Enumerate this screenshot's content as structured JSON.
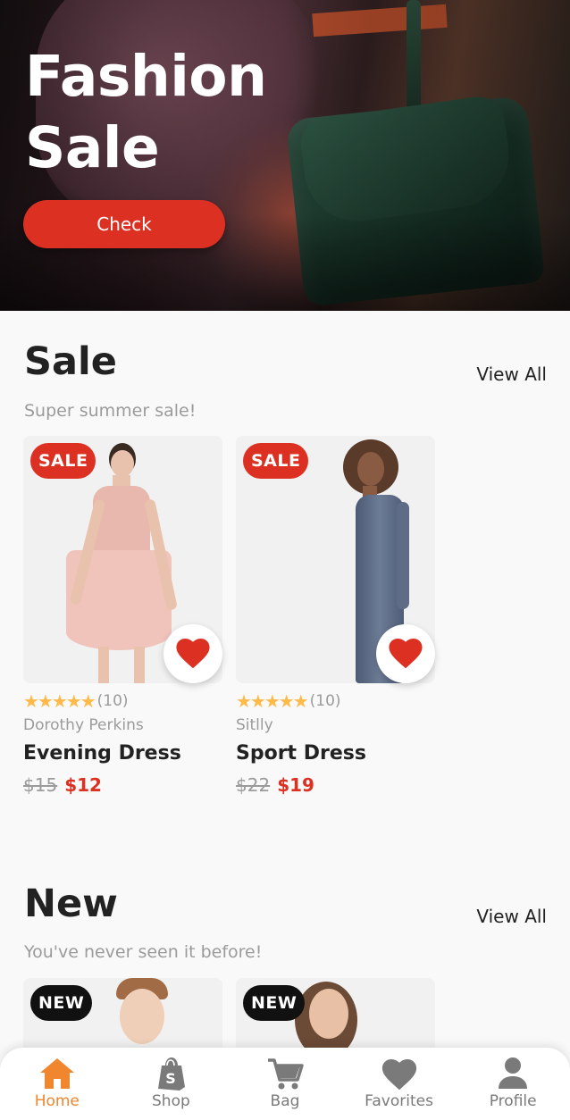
{
  "hero": {
    "title_line1": "Fashion",
    "title_line2": "Sale",
    "cta_label": "Check"
  },
  "sale": {
    "title": "Sale",
    "view_all": "View All",
    "subtitle": "Super summer sale!",
    "products": [
      {
        "badge": "SALE",
        "rating_stars": 5,
        "rating_count": "(10)",
        "brand": "Dorothy Perkins",
        "name": "Evening Dress",
        "old_price": "$15",
        "price": "$12"
      },
      {
        "badge": "SALE",
        "rating_stars": 5,
        "rating_count": "(10)",
        "brand": "Sitlly",
        "name": "Sport Dress",
        "old_price": "$22",
        "price": "$19"
      }
    ]
  },
  "new": {
    "title": "New",
    "view_all": "View All",
    "subtitle": "You've never seen it before!",
    "products": [
      {
        "badge": "NEW"
      },
      {
        "badge": "NEW"
      }
    ]
  },
  "nav": {
    "items": [
      {
        "label": "Home",
        "icon": "home-icon",
        "active": true
      },
      {
        "label": "Shop",
        "icon": "shop-bag-icon",
        "active": false
      },
      {
        "label": "Bag",
        "icon": "cart-icon",
        "active": false
      },
      {
        "label": "Favorites",
        "icon": "heart-icon",
        "active": false
      },
      {
        "label": "Profile",
        "icon": "person-icon",
        "active": false
      }
    ]
  },
  "colors": {
    "primary": "#db3022",
    "accent": "#f0862d",
    "star": "#ffba49",
    "muted": "#9b9b9b"
  }
}
